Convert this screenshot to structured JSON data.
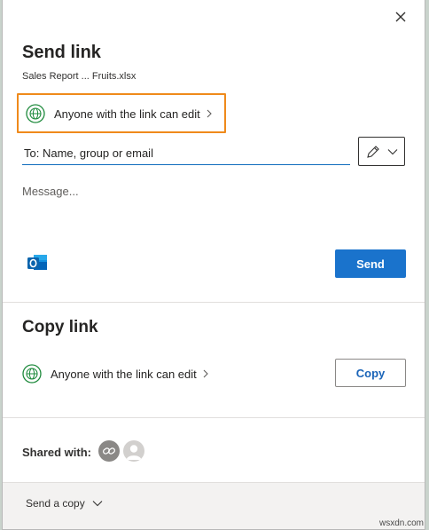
{
  "dialog": {
    "close_icon": "close-icon",
    "send_link": {
      "title": "Send link",
      "file_name": "Sales Report ... Fruits.xlsx",
      "permission": "Anyone with the link can edit",
      "to_placeholder": "To: Name, group or email",
      "to_value": "",
      "edit_dropdown_icon": "pencil-icon",
      "message_placeholder": "Message...",
      "message_value": "",
      "outlook_icon": "outlook-icon",
      "send_label": "Send"
    },
    "copy_link": {
      "title": "Copy link",
      "permission": "Anyone with the link can edit",
      "copy_label": "Copy"
    },
    "shared_with": {
      "label": "Shared with:",
      "avatars": [
        "link-avatar-icon",
        "person-avatar-icon"
      ]
    },
    "footer": {
      "send_copy_label": "Send a copy"
    }
  },
  "watermark": "wsxdn.com",
  "colors": {
    "accent": "#1a73cc",
    "highlight": "#ef8a1b",
    "globe": "#1e8a3c"
  }
}
